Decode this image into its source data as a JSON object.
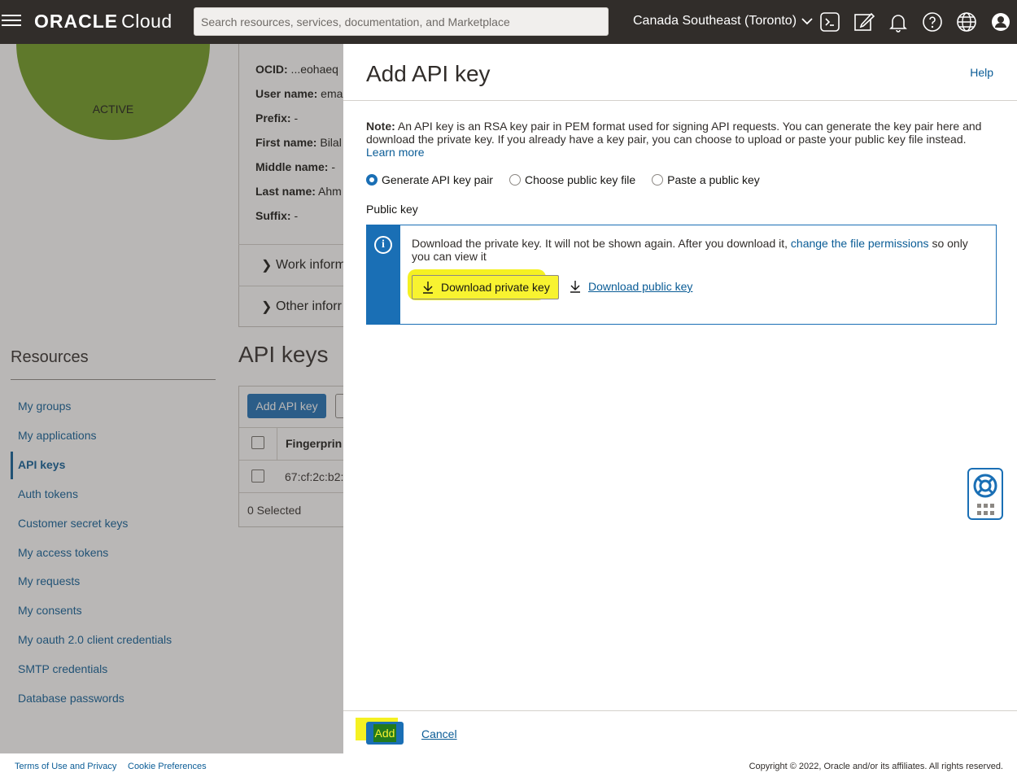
{
  "topbar": {
    "brand_main": "ORACLE",
    "brand_sub": "Cloud",
    "search_placeholder": "Search resources, services, documentation, and Marketplace",
    "region": "Canada Southeast (Toronto)"
  },
  "background": {
    "status": "ACTIVE",
    "user_info": [
      {
        "label": "OCID:",
        "value": " ...eohaeq"
      },
      {
        "label": "User name:",
        "value": " ema"
      },
      {
        "label": "Prefix:",
        "value": " -"
      },
      {
        "label": "First name:",
        "value": " Bilal"
      },
      {
        "label": "Middle name:",
        "value": " -"
      },
      {
        "label": "Last name:",
        "value": " Ahm"
      },
      {
        "label": "Suffix:",
        "value": " -"
      }
    ],
    "expanders": [
      "Work inform",
      "Other inforr"
    ],
    "resources_title": "Resources",
    "resources": [
      "My groups",
      "My applications",
      "API keys",
      "Auth tokens",
      "Customer secret keys",
      "My access tokens",
      "My requests",
      "My consents",
      "My oauth 2.0 client credentials",
      "SMTP credentials",
      "Database passwords"
    ],
    "apikeys_title": "API keys",
    "add_api_key_button": "Add API key",
    "fingerprint_header": "Fingerprin",
    "fingerprint_value": "67:cf:2c:b2:",
    "selected_text": "0 Selected"
  },
  "panel": {
    "title": "Add API key",
    "help": "Help",
    "note_label": "Note:",
    "note_text": " An API key is an RSA key pair in PEM format used for signing API requests. You can generate the key pair here and download the private key. If you already have a key pair, you can choose to upload or paste your public key file instead.",
    "learn_more": "Learn more",
    "radios": [
      {
        "label": "Generate API key pair",
        "checked": true
      },
      {
        "label": "Choose public key file",
        "checked": false
      },
      {
        "label": "Paste a public key",
        "checked": false
      }
    ],
    "public_key_label": "Public key",
    "info_text_before": "Download the private key. It will not be shown again. After you download it, ",
    "info_link": "change the file permissions",
    "info_text_after": " so only you can view it",
    "download_private": "Download private key",
    "download_public": "Download public key",
    "add_button": "Add",
    "cancel": "Cancel"
  },
  "footer": {
    "terms": "Terms of Use and Privacy",
    "cookies": "Cookie Preferences",
    "copyright": "Copyright © 2022, Oracle and/or its affiliates. All rights reserved."
  },
  "colors": {
    "topbar": "#312d2a",
    "accent": "#1a6fb5",
    "link": "#0a5c96",
    "highlight": "#f5f122",
    "status_green": "#6f9b1f"
  }
}
